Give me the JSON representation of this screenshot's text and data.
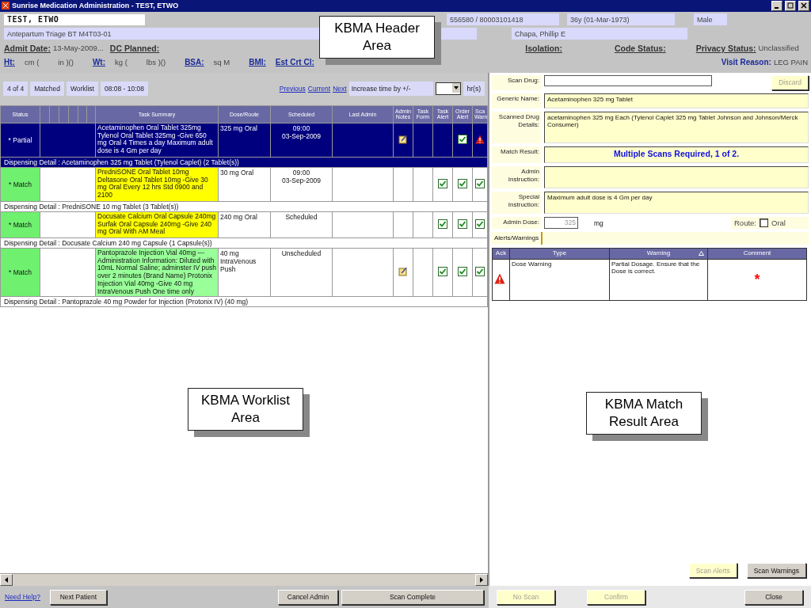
{
  "window": {
    "title": "Sunrise Medication Administration - TEST, ETWO"
  },
  "header": {
    "patient_name": "TEST, ETWO",
    "ids": "556580 / 80003101418",
    "age": "36y (01-Mar-1973)",
    "sex": "Male",
    "location": "Antepartum Triage BT M4T03-01",
    "physician": "Chapa, Phillip E",
    "admit_label": "Admit Date:",
    "admit_value": "13-May-2009...",
    "dc_label": "DC Planned:",
    "isolation_label": "Isolation:",
    "code_status_label": "Code Status:",
    "privacy_label": "Privacy Status:",
    "privacy_value": "Unclassified",
    "visit_label": "Visit Reason:",
    "visit_value": "LEG PAIN",
    "measures": [
      {
        "kind": "link",
        "text": "Ht:"
      },
      {
        "kind": "text",
        "text": "cm ("
      },
      {
        "kind": "text",
        "text": "in )()"
      },
      {
        "kind": "link",
        "text": "Wt:"
      },
      {
        "kind": "text",
        "text": "kg ("
      },
      {
        "kind": "text",
        "text": "lbs )()"
      },
      {
        "kind": "link",
        "text": "BSA:"
      },
      {
        "kind": "text",
        "text": "sq M"
      },
      {
        "kind": "link",
        "text": "BMI:"
      },
      {
        "kind": "link",
        "text": "Est Crt Cl:"
      }
    ]
  },
  "worklist": {
    "pills": [
      "4 of 4",
      "Matched",
      "Worklist",
      "08:08 - 10:08"
    ],
    "nav_links": [
      "Previous",
      "Current",
      "Next"
    ],
    "increase_label": "Increase time by +/-",
    "hours_unit": "hr(s)",
    "columns": [
      "Status",
      "Task Summary",
      "Dose/Route",
      "Scheduled",
      "Last Admin",
      "Admin Notes",
      "Task Form",
      "Task Alert",
      "Order Alert",
      "Sca Warn"
    ],
    "rows": [
      {
        "selected": true,
        "status": "* Partial",
        "matched": false,
        "summary": "Acetaminophen Oral Tablet 325mg Tylenol Oral Tablet 325mg -Give  650 mg Oral  4 Times a day  Maximum adult dose is 4 Gm per day",
        "dose": "325 mg Oral",
        "scheduled": [
          "09:00",
          "03-Sep-2009"
        ],
        "notes_icon": true,
        "task_alert": false,
        "order_alert": true,
        "scan_checked": false,
        "scan_warning": true,
        "detail": "Dispensing Detail : Acetaminophen  325 mg Tablet (Tylenol Caplet) (2 Tablet(s))"
      },
      {
        "selected": false,
        "status": "* Match",
        "matched": true,
        "color": "#ffff00",
        "summary": "PredniSONE Oral Tablet 10mg Deltasone Oral Tablet 10mg -Give  30 mg Oral  Every 12 hrs Std 0900 and 2100",
        "dose": "30 mg Oral",
        "scheduled": [
          "09:00",
          "03-Sep-2009"
        ],
        "notes_icon": false,
        "task_alert": true,
        "order_alert": true,
        "scan_checked": true,
        "scan_warning": false,
        "detail": "Dispensing Detail : PredniSONE 10 mg Tablet (3 Tablet(s))"
      },
      {
        "selected": false,
        "status": "* Match",
        "matched": true,
        "color": "#ffff00",
        "summary": "Docusate Calcium Oral Capsule 240mg Surfak Oral Capsule 240mg -Give  240 mg Oral  With AM Meal",
        "dose": "240 mg Oral",
        "scheduled": [
          "Scheduled"
        ],
        "notes_icon": false,
        "task_alert": true,
        "order_alert": true,
        "scan_checked": true,
        "scan_warning": false,
        "detail": "Dispensing Detail : Docusate Calcium 240 mg Capsule (1 Capsule(s))"
      },
      {
        "selected": false,
        "status": "* Match",
        "matched": true,
        "color": "#99ff99",
        "summary": "Pantoprazole Injection Vial 40mg  --- Administration Information: Diluted with 10mL Normal Saline; adminster IV push over 2 minutes (Brand Name) Protonix Injection Vial 40mg  -Give 40 mg IntraVenous Push One time only",
        "dose": "40 mg IntraVenous Push",
        "scheduled": [
          "Unscheduled"
        ],
        "notes_icon": true,
        "task_alert": true,
        "order_alert": true,
        "scan_checked": true,
        "scan_warning": false,
        "detail": "Dispensing Detail : Pantoprazole 40 mg Powder for Injection (Protonix IV) (40 mg)"
      }
    ]
  },
  "match": {
    "scan_label": "Scan Drug:",
    "discard": {
      "label": "Discard",
      "disabled": true
    },
    "fields": [
      {
        "kind": "single",
        "label": "Generic Name:",
        "value": "Acetaminophen 325 mg Tablet"
      },
      {
        "kind": "tall",
        "label": "Scanned Drug Details:",
        "value": "acetaminophen 325 mg Each (Tylenol Caplet 325 mg Tablet Johnson and Johnson/Merck Consumer)"
      },
      {
        "kind": "result",
        "label": "Match Result:",
        "value": "Multiple Scans Required, 1 of 2."
      },
      {
        "kind": "multi",
        "label": "Admin Instruction:"
      },
      {
        "kind": "multi",
        "label": "Special Instruction:",
        "value": "Maximum adult dose is 4 Gm per day"
      }
    ],
    "dose_label": "Admin Dose:",
    "dose_value": "325",
    "dose_unit": "mg",
    "route_label": "Route:",
    "route_option": "Oral",
    "route_checked": false,
    "alerts_tab": "Alerts/Warnings",
    "alerts_columns": [
      "Ack",
      "Type",
      "Warning",
      "Comment"
    ],
    "alerts": [
      {
        "type": "Dose Warning",
        "warning": "Partial Dosage.  Ensure that the Dose is correct.",
        "comment": "*"
      }
    ],
    "buttons": [
      {
        "label": "Scan Alerts",
        "disabled": true
      },
      {
        "label": "Scan Warnings",
        "disabled": false
      }
    ]
  },
  "footer": {
    "help_link": "Need Help?",
    "left_buttons": [
      "Next Patient",
      "Cancel Admin",
      "Scan Complete"
    ],
    "right_buttons": [
      {
        "label": "No Scan",
        "disabled": true
      },
      {
        "label": "Confirm",
        "disabled": true
      },
      {
        "label": "Close",
        "disabled": false
      }
    ]
  },
  "callouts": [
    {
      "text": "KBMA Header Area"
    },
    {
      "text": "KBMA Worklist Area"
    },
    {
      "text": "KBMA Match Result Area"
    }
  ]
}
